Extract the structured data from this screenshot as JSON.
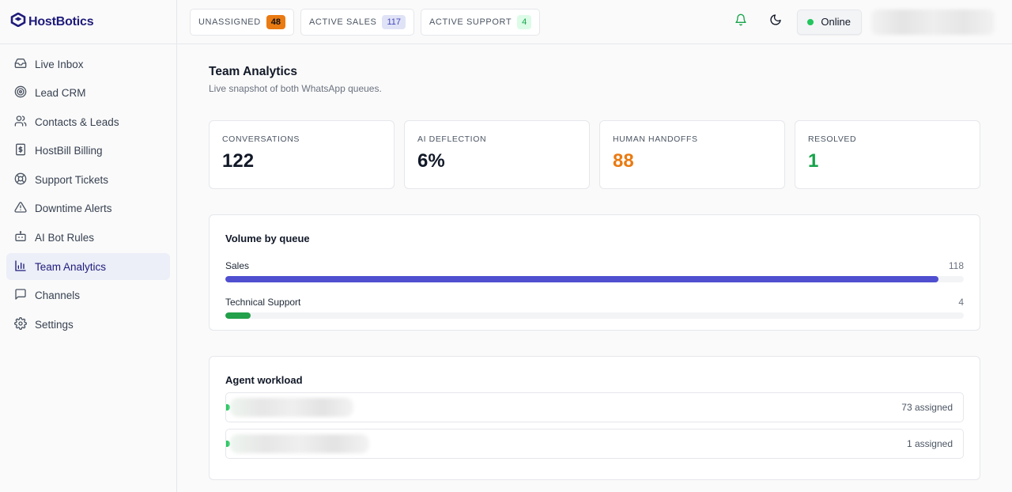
{
  "brand": {
    "name": "HostBotics"
  },
  "nav": {
    "items": [
      {
        "label": "Live Inbox",
        "icon": "inbox-icon"
      },
      {
        "label": "Lead CRM",
        "icon": "target-icon"
      },
      {
        "label": "Contacts & Leads",
        "icon": "users-icon"
      },
      {
        "label": "HostBill Billing",
        "icon": "dollar-icon"
      },
      {
        "label": "Support Tickets",
        "icon": "lifebuoy-icon"
      },
      {
        "label": "Downtime Alerts",
        "icon": "alert-triangle-icon"
      },
      {
        "label": "AI Bot Rules",
        "icon": "bot-icon"
      },
      {
        "label": "Team Analytics",
        "icon": "bar-chart-icon",
        "active": true
      },
      {
        "label": "Channels",
        "icon": "message-square-icon"
      },
      {
        "label": "Settings",
        "icon": "gear-icon"
      }
    ]
  },
  "topbar": {
    "unassigned": {
      "label": "UNASSIGNED",
      "count": "48"
    },
    "active_sales": {
      "label": "ACTIVE SALES",
      "count": "117"
    },
    "active_support": {
      "label": "ACTIVE SUPPORT",
      "count": "4"
    },
    "status_label": "Online"
  },
  "page": {
    "title": "Team Analytics",
    "subtitle": "Live snapshot of both WhatsApp queues."
  },
  "stats": [
    {
      "label": "CONVERSATIONS",
      "value": "122"
    },
    {
      "label": "AI DEFLECTION",
      "value": "6%"
    },
    {
      "label": "HUMAN HANDOFFS",
      "value": "88"
    },
    {
      "label": "RESOLVED",
      "value": "1"
    }
  ],
  "volume": {
    "title": "Volume by queue",
    "queues": [
      {
        "name": "Sales",
        "count": "118",
        "fill": 0.966,
        "color": "#4f4fd0"
      },
      {
        "name": "Technical Support",
        "count": "4",
        "fill": 0.034,
        "color": "#22a04a"
      }
    ]
  },
  "workload": {
    "title": "Agent workload",
    "agents": [
      {
        "assigned": "73 assigned"
      },
      {
        "assigned": "1 assigned"
      }
    ]
  },
  "colors": {
    "brand": "#1e1b7b",
    "accent_orange": "#ea7a12",
    "success_green": "#16a34a",
    "active_nav_bg": "#eceef8"
  }
}
